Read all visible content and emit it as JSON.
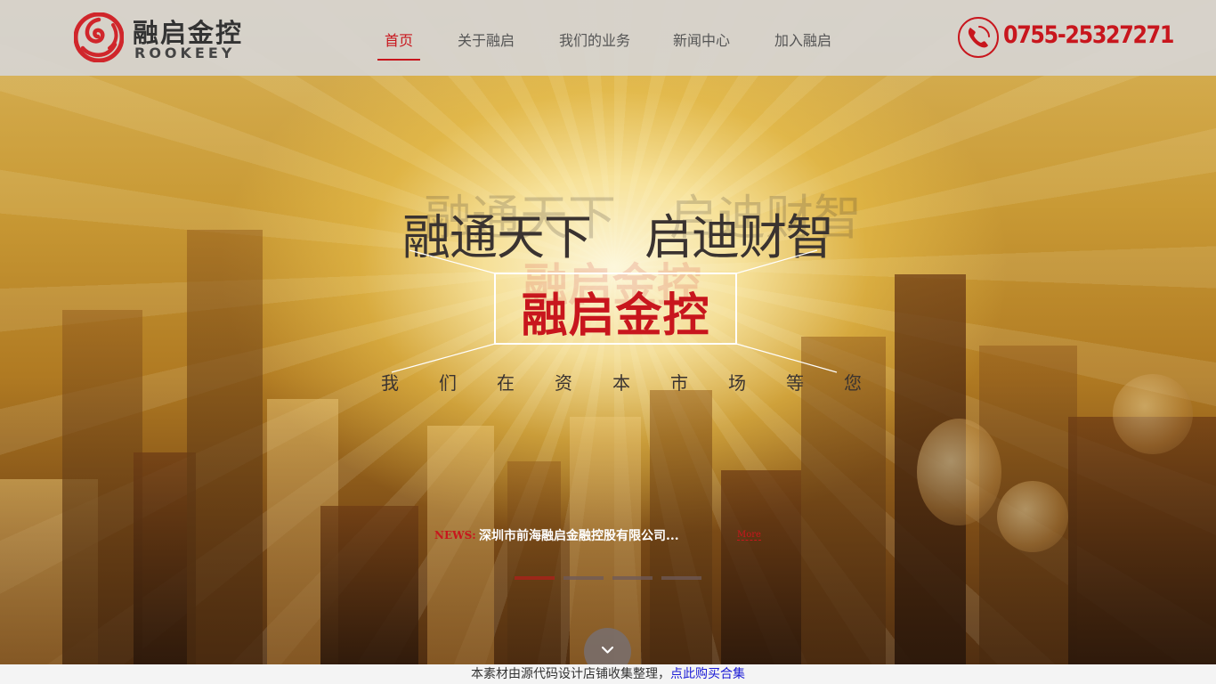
{
  "logo": {
    "cn": "融启金控",
    "en": "ROOKEEY"
  },
  "nav": {
    "items": [
      {
        "label": "首页",
        "active": true
      },
      {
        "label": "关于融启",
        "active": false
      },
      {
        "label": "我们的业务",
        "active": false
      },
      {
        "label": "新闻中心",
        "active": false
      },
      {
        "label": "加入融启",
        "active": false
      }
    ]
  },
  "contact": {
    "phone": "0755-25327271",
    "icon": "phone-icon"
  },
  "hero": {
    "slogan_left": "融通天下",
    "slogan_right": "启迪财智",
    "brand": "融启金控",
    "tagline": [
      "我",
      "们",
      "在",
      "资",
      "本",
      "市",
      "场",
      "等",
      "您"
    ]
  },
  "news": {
    "label": "NEWS:",
    "headline": "深圳市前海融启金融控股有限公司...",
    "more": "More"
  },
  "slider": {
    "count": 4,
    "active_index": 0
  },
  "footer": {
    "text": "本素材由源代码设计店铺收集整理，",
    "link": "点此购买合集"
  },
  "colors": {
    "accent": "#c8161d",
    "header_bg": "#d6d4d2",
    "link": "#1a1ad6"
  }
}
